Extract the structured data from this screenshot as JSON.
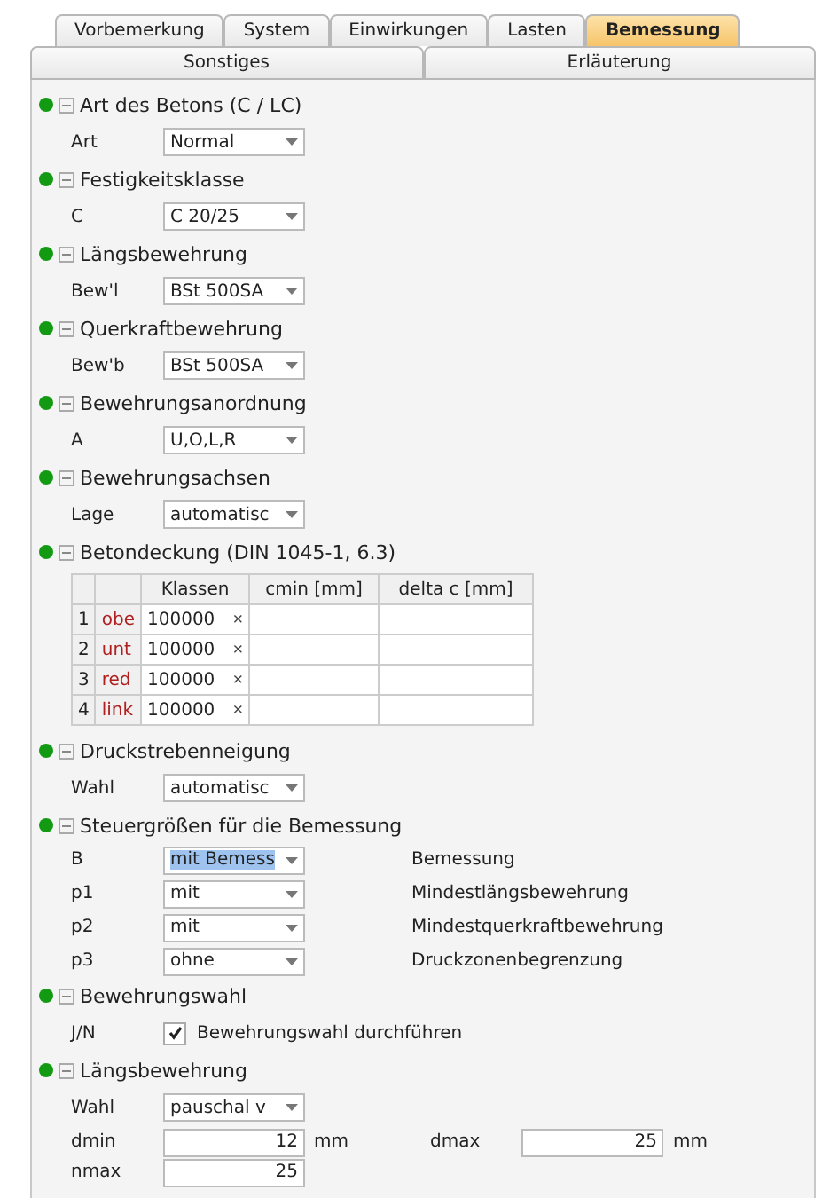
{
  "tabs_main": [
    {
      "label": "Vorbemerkung",
      "selected": false
    },
    {
      "label": "System",
      "selected": false
    },
    {
      "label": "Einwirkungen",
      "selected": false
    },
    {
      "label": "Lasten",
      "selected": false
    },
    {
      "label": "Bemessung",
      "selected": true
    }
  ],
  "tabs_sub": [
    {
      "label": "Sonstiges",
      "selected": false
    },
    {
      "label": "Erläuterung",
      "selected": false
    }
  ],
  "sections": [
    {
      "title": "Art des Betons (C / LC)",
      "expanded": true,
      "rows": [
        {
          "kind": "select",
          "label": "Art",
          "value": "Normal"
        }
      ]
    },
    {
      "title": "Festigkeitsklasse",
      "expanded": true,
      "rows": [
        {
          "kind": "select",
          "label": "C",
          "value": "C 20/25"
        }
      ]
    },
    {
      "title": "Längsbewehrung",
      "expanded": true,
      "rows": [
        {
          "kind": "select",
          "label": "Bew'l",
          "value": "BSt 500SA"
        }
      ]
    },
    {
      "title": "Querkraftbewehrung",
      "expanded": true,
      "rows": [
        {
          "kind": "select",
          "label": "Bew'b",
          "value": "BSt 500SA"
        }
      ]
    },
    {
      "title": "Bewehrungsanordnung",
      "expanded": true,
      "rows": [
        {
          "kind": "select",
          "label": "A",
          "value": "U,O,L,R"
        }
      ]
    },
    {
      "title": "Bewehrungsachsen",
      "expanded": true,
      "rows": [
        {
          "kind": "select",
          "label": "Lage",
          "value": "automatisc"
        }
      ]
    },
    {
      "title": "Betondeckung (DIN 1045-1, 6.3)",
      "expanded": true,
      "rows": [
        {
          "kind": "table",
          "columns": [
            "Klassen",
            "cmin  [mm]",
            "delta c  [mm]"
          ],
          "rows": [
            {
              "num": "1",
              "code": "obe",
              "klassen": "100000",
              "remove": "×"
            },
            {
              "num": "2",
              "code": "unt",
              "klassen": "100000",
              "remove": "×"
            },
            {
              "num": "3",
              "code": "red",
              "klassen": "100000",
              "remove": "×"
            },
            {
              "num": "4",
              "code": "link",
              "klassen": "100000",
              "remove": "×"
            }
          ]
        }
      ]
    },
    {
      "title": "Druckstrebenneigung",
      "expanded": true,
      "rows": [
        {
          "kind": "select",
          "label": "Wahl",
          "value": "automatisc"
        }
      ]
    },
    {
      "title": "Steuergrößen für die Bemessung",
      "expanded": true,
      "rows": [
        {
          "kind": "select",
          "label": "B",
          "value": "mit Bemess",
          "focused": true,
          "description": "Bemessung"
        },
        {
          "kind": "select",
          "label": "p1",
          "value": "mit",
          "focused": false,
          "description": "Mindestlängsbewehrung"
        },
        {
          "kind": "select",
          "label": "p2",
          "value": "mit",
          "focused": false,
          "description": "Mindestquerkraftbewehrung"
        },
        {
          "kind": "select",
          "label": "p3",
          "value": "ohne",
          "focused": false,
          "description": "Druckzonenbegrenzung"
        }
      ]
    },
    {
      "title": "Bewehrungswahl",
      "expanded": true,
      "rows": [
        {
          "kind": "checkbox",
          "label": "J/N",
          "checked": true,
          "text": "Bewehrungswahl durchführen"
        }
      ]
    },
    {
      "title": "Längsbewehrung",
      "expanded": true,
      "rows": [
        {
          "kind": "select",
          "label": "Wahl",
          "value": "pauschal v"
        },
        {
          "kind": "number2",
          "label": "dmin",
          "value": "12",
          "unit": "mm",
          "label2": "dmax",
          "value2": "25",
          "unit2": "mm"
        },
        {
          "kind": "number",
          "label": "nmax",
          "value": "25"
        }
      ]
    }
  ]
}
